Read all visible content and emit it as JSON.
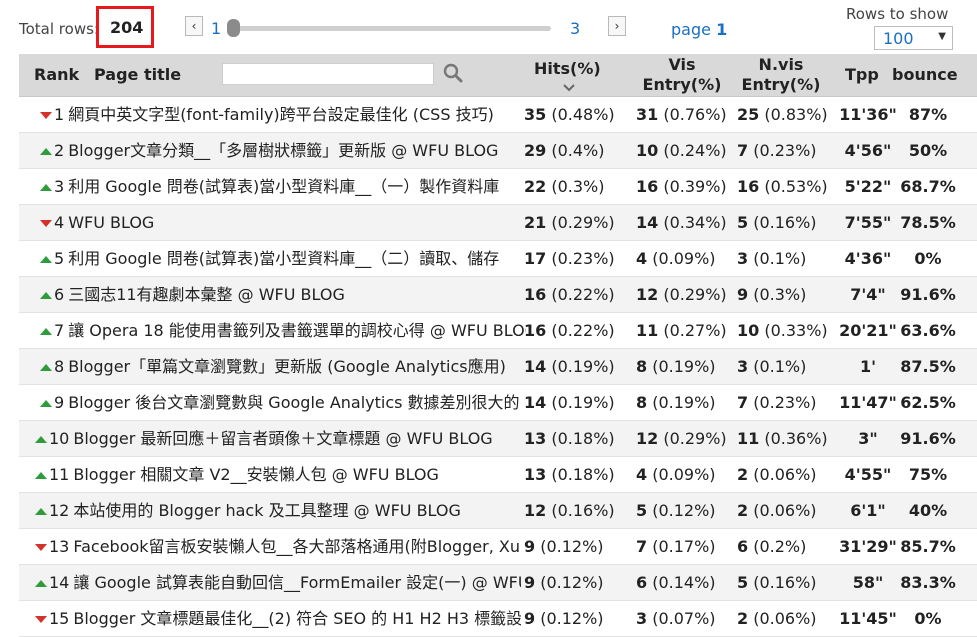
{
  "top": {
    "total_label": "Total rows:",
    "total_value": "204",
    "prev_icon": "‹",
    "next_icon": "›",
    "page_start": "1",
    "page_end": "3",
    "page_label": "page",
    "page_current": "1",
    "rows_label": "Rows to show",
    "rows_value": "100"
  },
  "columns": {
    "rank": "Rank",
    "title": "Page title",
    "hits": "Hits(%)",
    "vis_1": "Vis",
    "vis_2": "Entry(%)",
    "nvis_1": "N.vis",
    "nvis_2": "Entry(%)",
    "tpp": "Tpp",
    "bounce": "bounce"
  },
  "search": {
    "placeholder": ""
  },
  "colors": {
    "highlight_box": "#e8191d",
    "trend_up": "#2e9c3b",
    "trend_down": "#d1322a",
    "link": "#1a6fc0"
  },
  "rows": [
    {
      "rank": "1",
      "trend": "down",
      "title": "網頁中英文字型(font-family)跨平台設定最佳化 (CSS 技巧)",
      "hits": "35",
      "hits_pct": "(0.48%)",
      "vis": "31",
      "vis_pct": "(0.76%)",
      "nvis": "25",
      "nvis_pct": "(0.83%)",
      "tpp": "11'36\"",
      "bounce": "87%"
    },
    {
      "rank": "2",
      "trend": "up",
      "title": "Blogger文章分類__「多層樹狀標籤」更新版 @ WFU BLOG",
      "hits": "29",
      "hits_pct": "(0.4%)",
      "vis": "10",
      "vis_pct": "(0.24%)",
      "nvis": "7",
      "nvis_pct": "(0.23%)",
      "tpp": "4'56\"",
      "bounce": "50%"
    },
    {
      "rank": "3",
      "trend": "up",
      "title": "利用 Google 問卷(試算表)當小型資料庫__（一）製作資料庫",
      "hits": "22",
      "hits_pct": "(0.3%)",
      "vis": "16",
      "vis_pct": "(0.39%)",
      "nvis": "16",
      "nvis_pct": "(0.53%)",
      "tpp": "5'22\"",
      "bounce": "68.7%"
    },
    {
      "rank": "4",
      "trend": "down",
      "title": "WFU BLOG",
      "hits": "21",
      "hits_pct": "(0.29%)",
      "vis": "14",
      "vis_pct": "(0.34%)",
      "nvis": "5",
      "nvis_pct": "(0.16%)",
      "tpp": "7'55\"",
      "bounce": "78.5%"
    },
    {
      "rank": "5",
      "trend": "up",
      "title": "利用 Google 問卷(試算表)當小型資料庫__（二）讀取、儲存",
      "hits": "17",
      "hits_pct": "(0.23%)",
      "vis": "4",
      "vis_pct": "(0.09%)",
      "nvis": "3",
      "nvis_pct": "(0.1%)",
      "tpp": "4'36\"",
      "bounce": "0%"
    },
    {
      "rank": "6",
      "trend": "up",
      "title": "三國志11有趣劇本彙整 @ WFU BLOG",
      "hits": "16",
      "hits_pct": "(0.22%)",
      "vis": "12",
      "vis_pct": "(0.29%)",
      "nvis": "9",
      "nvis_pct": "(0.3%)",
      "tpp": "7'4\"",
      "bounce": "91.6%"
    },
    {
      "rank": "7",
      "trend": "up",
      "title": "讓 Opera 18 能使用書籤列及書籤選單的調校心得 @ WFU BLOG",
      "hits": "16",
      "hits_pct": "(0.22%)",
      "vis": "11",
      "vis_pct": "(0.27%)",
      "nvis": "10",
      "nvis_pct": "(0.33%)",
      "tpp": "20'21\"",
      "bounce": "63.6%"
    },
    {
      "rank": "8",
      "trend": "up",
      "title": "Blogger「單篇文章瀏覽數」更新版 (Google Analytics應用)",
      "hits": "14",
      "hits_pct": "(0.19%)",
      "vis": "8",
      "vis_pct": "(0.19%)",
      "nvis": "3",
      "nvis_pct": "(0.1%)",
      "tpp": "1'",
      "bounce": "87.5%"
    },
    {
      "rank": "9",
      "trend": "up",
      "title": "Blogger 後台文章瀏覽數與 Google Analytics 數據差別很大的",
      "hits": "14",
      "hits_pct": "(0.19%)",
      "vis": "8",
      "vis_pct": "(0.19%)",
      "nvis": "7",
      "nvis_pct": "(0.23%)",
      "tpp": "11'47\"",
      "bounce": "62.5%"
    },
    {
      "rank": "10",
      "trend": "up",
      "title": "Blogger 最新回應＋留言者頭像＋文章標題 @ WFU BLOG",
      "hits": "13",
      "hits_pct": "(0.18%)",
      "vis": "12",
      "vis_pct": "(0.29%)",
      "nvis": "11",
      "nvis_pct": "(0.36%)",
      "tpp": "3\"",
      "bounce": "91.6%"
    },
    {
      "rank": "11",
      "trend": "up",
      "title": "Blogger 相關文章 V2__安裝懶人包 @ WFU BLOG",
      "hits": "13",
      "hits_pct": "(0.18%)",
      "vis": "4",
      "vis_pct": "(0.09%)",
      "nvis": "2",
      "nvis_pct": "(0.06%)",
      "tpp": "4'55\"",
      "bounce": "75%"
    },
    {
      "rank": "12",
      "trend": "up",
      "title": "本站使用的 Blogger hack 及工具整理 @ WFU BLOG",
      "hits": "12",
      "hits_pct": "(0.16%)",
      "vis": "5",
      "vis_pct": "(0.12%)",
      "nvis": "2",
      "nvis_pct": "(0.06%)",
      "tpp": "6'1\"",
      "bounce": "40%"
    },
    {
      "rank": "13",
      "trend": "down",
      "title": "Facebook留言板安裝懶人包__各大部落格通用(附Blogger, Xuite",
      "hits": "9",
      "hits_pct": "(0.12%)",
      "vis": "7",
      "vis_pct": "(0.17%)",
      "nvis": "6",
      "nvis_pct": "(0.2%)",
      "tpp": "31'29\"",
      "bounce": "85.7%"
    },
    {
      "rank": "14",
      "trend": "up",
      "title": "讓 Google 試算表能自動回信__FormEmailer 設定(一) @ WFU",
      "hits": "9",
      "hits_pct": "(0.12%)",
      "vis": "6",
      "vis_pct": "(0.14%)",
      "nvis": "5",
      "nvis_pct": "(0.16%)",
      "tpp": "58\"",
      "bounce": "83.3%"
    },
    {
      "rank": "15",
      "trend": "down",
      "title": "Blogger 文章標題最佳化__(2) 符合 SEO 的 H1 H2 H3 標籤設定",
      "hits": "9",
      "hits_pct": "(0.12%)",
      "vis": "3",
      "vis_pct": "(0.07%)",
      "nvis": "2",
      "nvis_pct": "(0.06%)",
      "tpp": "11'45\"",
      "bounce": "0%"
    }
  ]
}
